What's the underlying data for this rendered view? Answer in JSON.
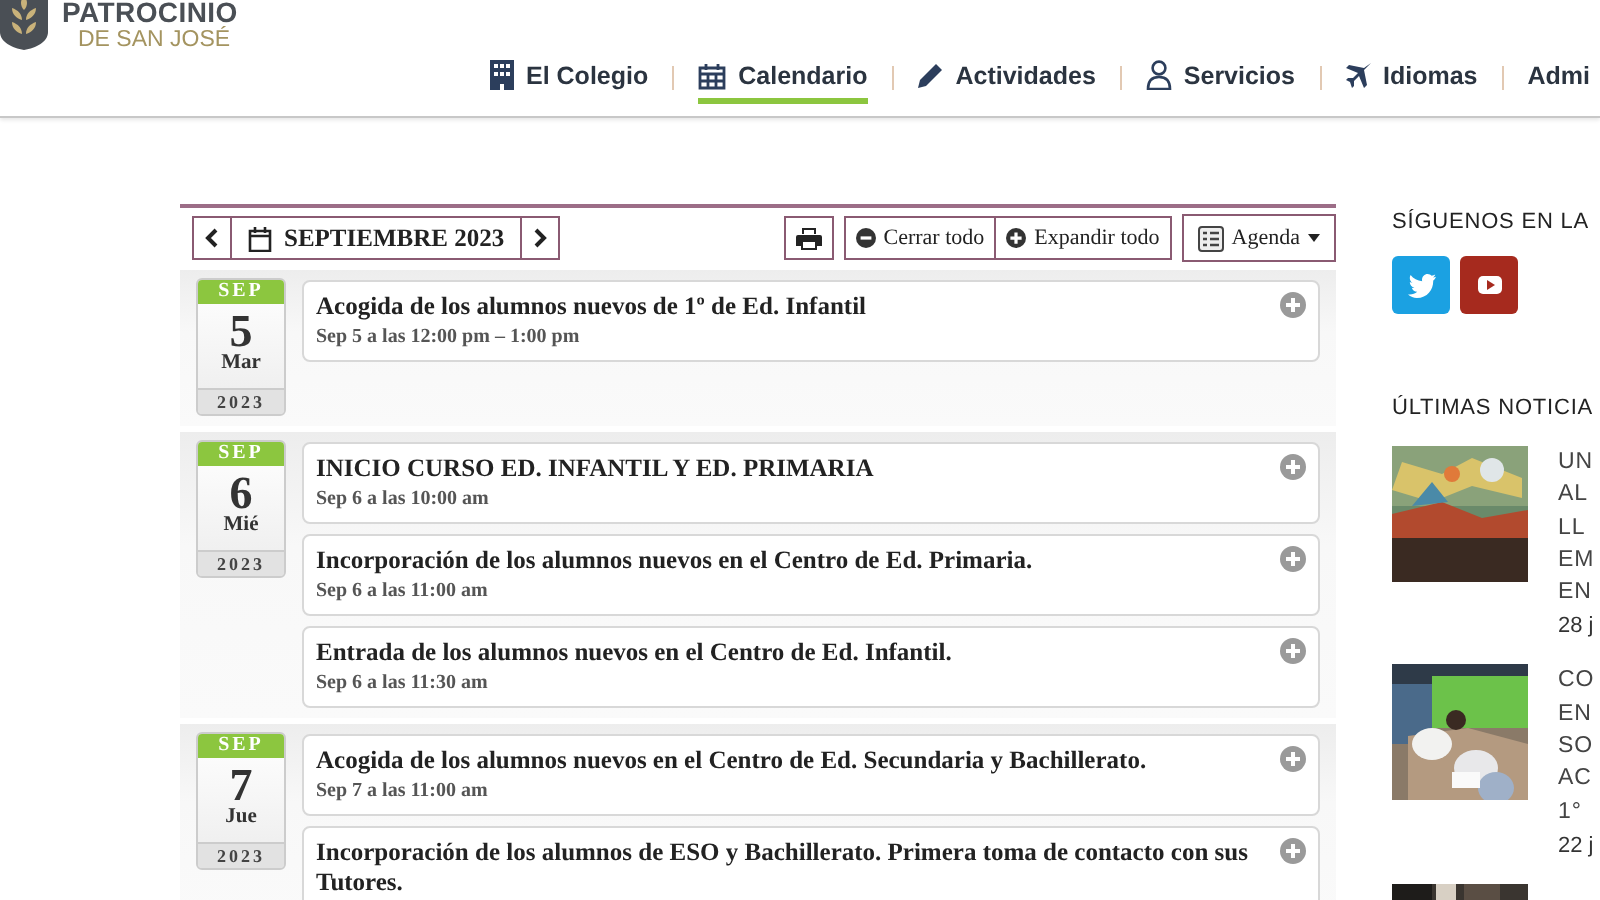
{
  "logo": {
    "name": "PATROCINIO",
    "subtitle": "DE SAN JOSÉ"
  },
  "nav": [
    {
      "label": "El Colegio",
      "kind": "building",
      "selected": false
    },
    {
      "label": "Calendario",
      "kind": "calendar",
      "selected": true
    },
    {
      "label": "Actividades",
      "kind": "pencil",
      "selected": false
    },
    {
      "label": "Servicios",
      "kind": "user",
      "selected": false
    },
    {
      "label": "Idiomas",
      "kind": "plane",
      "selected": false
    },
    {
      "label": "Admi",
      "selected": false
    }
  ],
  "calendar": {
    "month": "SEPTIEMBRE 2023",
    "actions": [
      {
        "label": "Cerrar todo",
        "kind": "collapse"
      },
      {
        "label": "Expandir todo",
        "kind": "expand"
      }
    ],
    "view": "Agenda",
    "days": [
      {
        "month": "SEP",
        "day": "5",
        "weekday": "Mar",
        "year": "2023",
        "events": [
          {
            "title": "Acogida de los alumnos nuevos de 1º de Ed. Infantil",
            "time": "Sep 5 a las 12:00 pm – 1:00 pm"
          }
        ]
      },
      {
        "month": "SEP",
        "day": "6",
        "weekday": "Mié",
        "year": "2023",
        "events": [
          {
            "title": "INICIO CURSO ED. INFANTIL Y ED. PRIMARIA",
            "time": "Sep 6 a las 10:00 am"
          },
          {
            "title": "Incorporación de los alumnos nuevos en el Centro de Ed. Primaria.",
            "time": "Sep 6 a las 11:00 am"
          },
          {
            "title": "Entrada de los alumnos nuevos en el Centro de Ed. Infantil.",
            "time": "Sep 6 a las 11:30 am"
          }
        ]
      },
      {
        "month": "SEP",
        "day": "7",
        "weekday": "Jue",
        "year": "2023",
        "events": [
          {
            "title": "Acogida de los alumnos nuevos en el Centro de Ed. Secundaria y Bachillerato.",
            "time": "Sep 7 a las 11:00 am"
          },
          {
            "title": "Incorporación de los alumnos de ESO y Bachillerato. Primera toma de contacto con sus Tutores."
          }
        ]
      }
    ]
  },
  "sidebar": {
    "follow_title": "SÍGUENOS EN LA",
    "social": [
      {
        "kind": "twitter",
        "color": "#1ba1e2"
      },
      {
        "kind": "youtube",
        "color": "#a62a1e"
      }
    ],
    "news_title": "ÚLTIMAS NOTICIA",
    "news": [
      {
        "kind": "picture",
        "title_lines": [
          "UN",
          "AL",
          "LL",
          "EM",
          "EN"
        ],
        "date": "28 j"
      },
      {
        "kind": "picture",
        "title_lines": [
          "CO",
          "EN",
          "SO",
          "AC",
          "1°"
        ],
        "date": "22 j"
      },
      {
        "kind": "picture"
      }
    ]
  }
}
